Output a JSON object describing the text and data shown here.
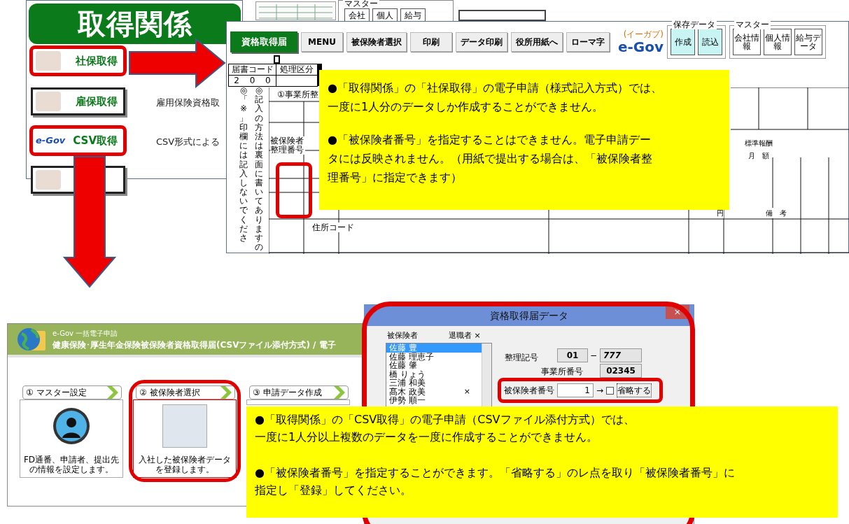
{
  "menu_panel": {
    "title": "取得関係",
    "items": [
      {
        "label": "社保取得",
        "kind": "photo",
        "highlighted": true
      },
      {
        "label": "雇保取得",
        "kind": "photo",
        "highlighted": false,
        "description": "雇用保険資格取"
      },
      {
        "label": "CSV取得",
        "kind": "egov",
        "logo": "e-Gov",
        "highlighted": true,
        "description": "CSV形式による"
      },
      {
        "kind": "photo",
        "highlighted": false
      }
    ]
  },
  "mini_master": {
    "label": "マスター",
    "buttons": [
      "会社",
      "個人",
      "給与"
    ]
  },
  "form_window": {
    "toolbar": {
      "title_button": "資格取得届",
      "buttons": [
        "MENU",
        "被保険者選択",
        "印刷",
        "データ印刷",
        "役所用紙へ",
        "ローマ字"
      ],
      "logo": "e-Gov",
      "logo_caption": "(イーガブ)",
      "save_group": {
        "label": "保存データ",
        "buttons": [
          "作成",
          "読込"
        ]
      },
      "master_group": {
        "label": "マスター",
        "buttons": [
          "会社情報",
          "個人情報",
          "給与データ"
        ]
      }
    },
    "form": {
      "code_label": "届書コード",
      "process_label": "処理区分",
      "code_digits": [
        "2",
        "0",
        "0"
      ],
      "office_label": "①事業所整",
      "vertical_notes": [
        "◎「※」印欄には記入しないでくださ",
        "◎記入の方法は裏面に書いてありますの"
      ],
      "insured_number_label": "被保険者整理番号",
      "postal_label": "住所コード",
      "salary_label": "標準報酬",
      "monthly_label": "月　額",
      "remarks_label": "備　考",
      "yen": "円"
    },
    "note": [
      [
        "●「取得関係」の「社保取得」の電子申請（様式記入方式）では、",
        "一度に1人分のデータしか作成することができません。"
      ],
      [
        "●「被保険者番号」を指定することはできません。電子申請デー",
        "タには反映されません。（用紙で提出する場合は、「被保険者整",
        "理番号」に指定できます）"
      ]
    ]
  },
  "egov_app": {
    "subtitle": "e-Gov 一括電子申請",
    "title": "健康保険･厚生年金保険被保険者資格取得届(CSVファイル添付方式) / 電子",
    "steps": [
      {
        "label": "① マスター設定",
        "kind": "avatar",
        "highlighted": false,
        "description": "FD通番、申請者、提出先の情報を設定します。"
      },
      {
        "label": "② 被保険者選択",
        "kind": "screenshot",
        "highlighted": true,
        "description": "入社した被保険者データを登録します。"
      },
      {
        "label": "③ 申請データ作成",
        "kind": "none",
        "highlighted": false
      }
    ]
  },
  "dialog": {
    "title": "資格取得届データ",
    "close": "×",
    "list_label": "被保険者",
    "retired_label": "退職者 ×",
    "people": [
      {
        "name": "佐藤 豊",
        "selected": true,
        "retired": false
      },
      {
        "name": "佐藤 理恵子",
        "selected": false,
        "retired": false
      },
      {
        "name": "佐藤 肇",
        "selected": false,
        "retired": false
      },
      {
        "name": "橋 りょう",
        "selected": false,
        "retired": false
      },
      {
        "name": "三浦 和美",
        "selected": false,
        "retired": false
      },
      {
        "name": "髙木 政美",
        "selected": false,
        "retired": true
      },
      {
        "name": "伊勢 順一",
        "selected": false,
        "retired": false
      }
    ],
    "retired_mark": "×",
    "code_label": "整理記号",
    "code_1": "01",
    "dash": "−",
    "code_2": "777",
    "office_label": "事業所番号",
    "office_number": "02345",
    "insured_label": "被保険者番号",
    "insured_value": "1",
    "arrow": "→",
    "omit_label": "省略する",
    "omit_checked": false
  },
  "note2": [
    [
      "●「取得関係」の「CSV取得」の電子申請（CSVファイル添付方式）では、",
      "一度に1人分以上複数のデータを一度に作成することができません。"
    ],
    [
      "●「被保険者番号」を指定することができます。「省略する」のレ点を取り「被保険者番号」に",
      "指定し「登録」してください。"
    ]
  ]
}
